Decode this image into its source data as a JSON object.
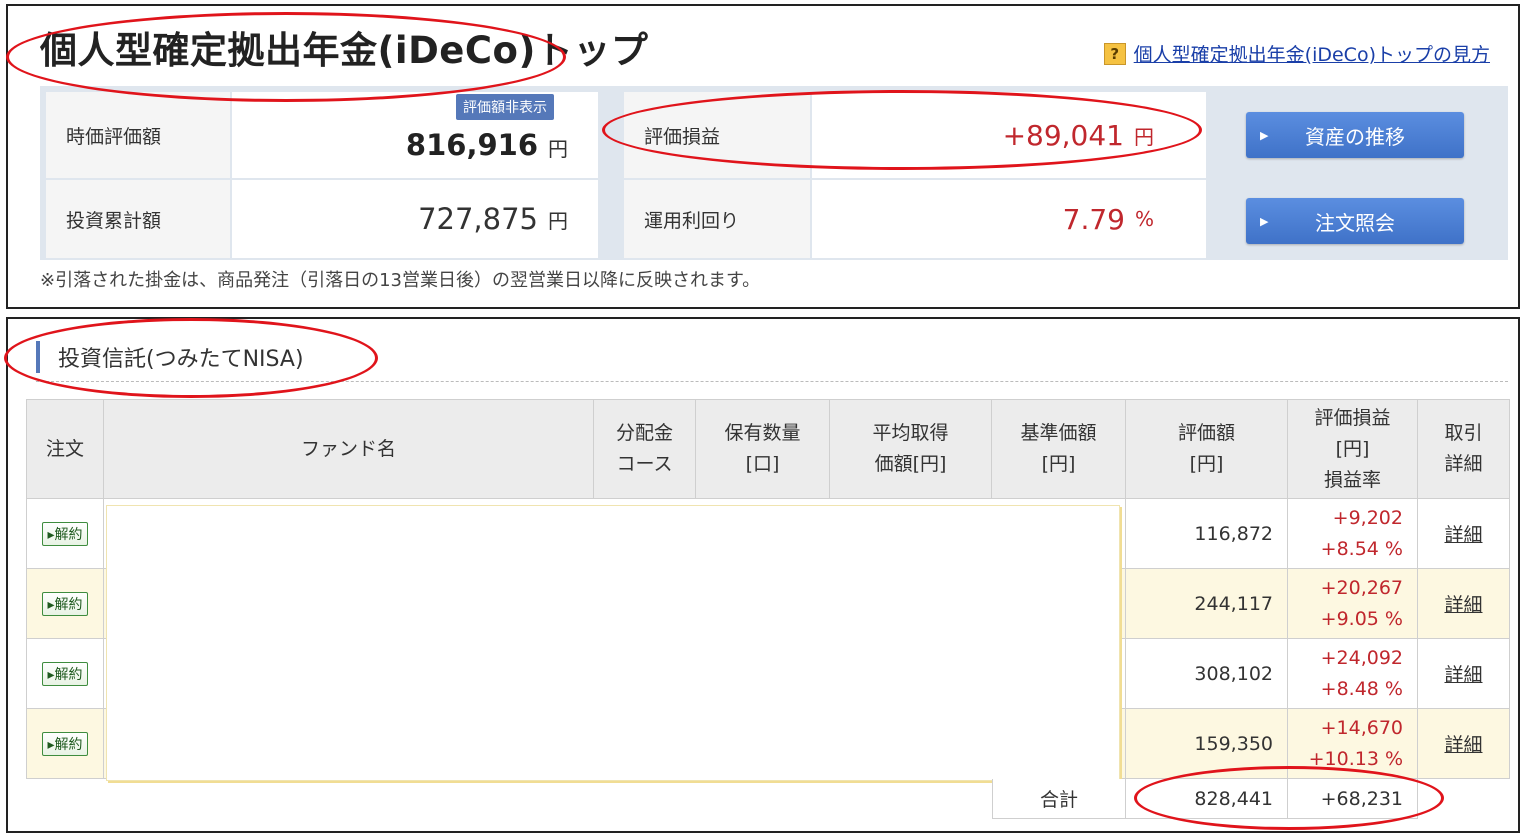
{
  "top": {
    "title": "個人型確定拠出年金(iDeCo)トップ",
    "help_icon": "?",
    "help_link": "個人型確定拠出年金(iDeCo)トップの見方",
    "market_value_label": "時価評価額",
    "market_value": "816,916",
    "hide_badge": "評価額非表示",
    "pl_label": "評価損益",
    "pl_value": "+89,041",
    "invested_label": "投資累計額",
    "invested_value": "727,875",
    "yield_label": "運用利回り",
    "yield_value": "7.79",
    "yen": "円",
    "percent": "%",
    "btn_assets": "資産の推移",
    "btn_orders": "注文照会",
    "note": "※引落された掛金は、商品発注（引落日の13営業日後）の翌営業日以降に反映されます。"
  },
  "bottom": {
    "section_title": "投資信託(つみたてNISA)",
    "headers": {
      "order": "注文",
      "fund": "ファンド名",
      "dist_1": "分配金",
      "dist_2": "コース",
      "qty_1": "保有数量",
      "qty_2": "[口]",
      "avg_1": "平均取得",
      "avg_2": "価額[円]",
      "base_1": "基準価額",
      "base_2": "[円]",
      "value_1": "評価額",
      "value_2": "[円]",
      "pl_1": "評価損益",
      "pl_2": "[円]",
      "pl_3": "損益率",
      "detail_1": "取引",
      "detail_2": "詳細"
    },
    "rows": [
      {
        "cancel": "▸解約",
        "value": "116,872",
        "pl": "+9,202",
        "rate": "+8.54 %",
        "detail": "詳細"
      },
      {
        "cancel": "▸解約",
        "value": "244,117",
        "pl": "+20,267",
        "rate": "+9.05 %",
        "detail": "詳細"
      },
      {
        "cancel": "▸解約",
        "value": "308,102",
        "pl": "+24,092",
        "rate": "+8.48 %",
        "detail": "詳細"
      },
      {
        "cancel": "▸解約",
        "value": "159,350",
        "pl": "+14,670",
        "rate": "+10.13 %",
        "detail": "詳細"
      }
    ],
    "total_label": "合計",
    "total_value": "828,441",
    "total_pl": "+68,231"
  },
  "colors": {
    "accent": "#5578b9",
    "button": "#4a7fd4",
    "gain": "#c0272d",
    "row_alt": "#fdf8e1",
    "annotation": "#e0141b"
  }
}
